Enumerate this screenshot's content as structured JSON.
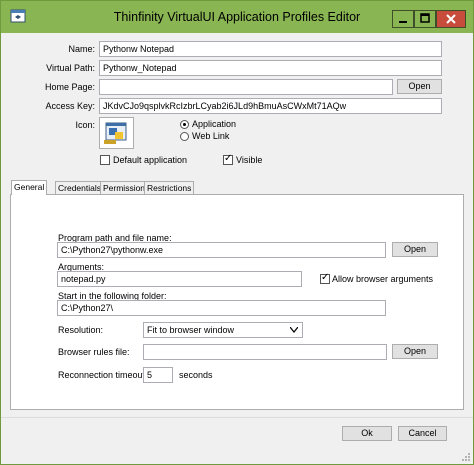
{
  "window": {
    "title": "Thinfinity VirtualUI Application Profiles Editor",
    "controls": [
      "minimize",
      "maximize",
      "close"
    ]
  },
  "header": {
    "name_label": "Name:",
    "name_value": "Pythonw Notepad",
    "virtual_path_label": "Virtual Path:",
    "virtual_path_value": "Pythonw_Notepad",
    "home_page_label": "Home Page:",
    "home_page_value": "",
    "open_label": "Open",
    "access_key_label": "Access Key:",
    "access_key_value": "JKdvCJo9qsplvkRcIzbrLCyab2i6JLd9hBmuAsCWxMt71AQw",
    "icon_label": "Icon:",
    "type_options": [
      {
        "label": "Application",
        "selected": true
      },
      {
        "label": "Web Link",
        "selected": false
      }
    ],
    "default_app_label": "Default application",
    "default_app_checked": false,
    "visible_label": "Visible",
    "visible_checked": true
  },
  "tabs": [
    {
      "label": "General",
      "active": true
    },
    {
      "label": "Credentials",
      "active": false
    },
    {
      "label": "Permissions",
      "active": false
    },
    {
      "label": "Restrictions",
      "active": false
    }
  ],
  "general": {
    "program_path_label": "Program path and file name:",
    "program_path_value": "C:\\Python27\\pythonw.exe",
    "program_open_label": "Open",
    "arguments_label": "Arguments:",
    "arguments_value": "notepad.py",
    "allow_args_label": "Allow browser arguments",
    "allow_args_checked": true,
    "start_folder_label": "Start in the following folder:",
    "start_folder_value": "C:\\Python27\\",
    "resolution_label": "Resolution:",
    "resolution_value": "Fit to browser window",
    "browser_rules_label": "Browser rules file:",
    "browser_rules_value": "",
    "browser_rules_open_label": "Open",
    "reconnection_label": "Reconnection timeout:",
    "reconnection_value": "5",
    "reconnection_unit": "seconds"
  },
  "footer": {
    "ok_label": "Ok",
    "cancel_label": "Cancel"
  },
  "colors": {
    "titlebar": "#8ab553",
    "close_button": "#c74c3c",
    "window_bg": "#f0f0f0"
  }
}
